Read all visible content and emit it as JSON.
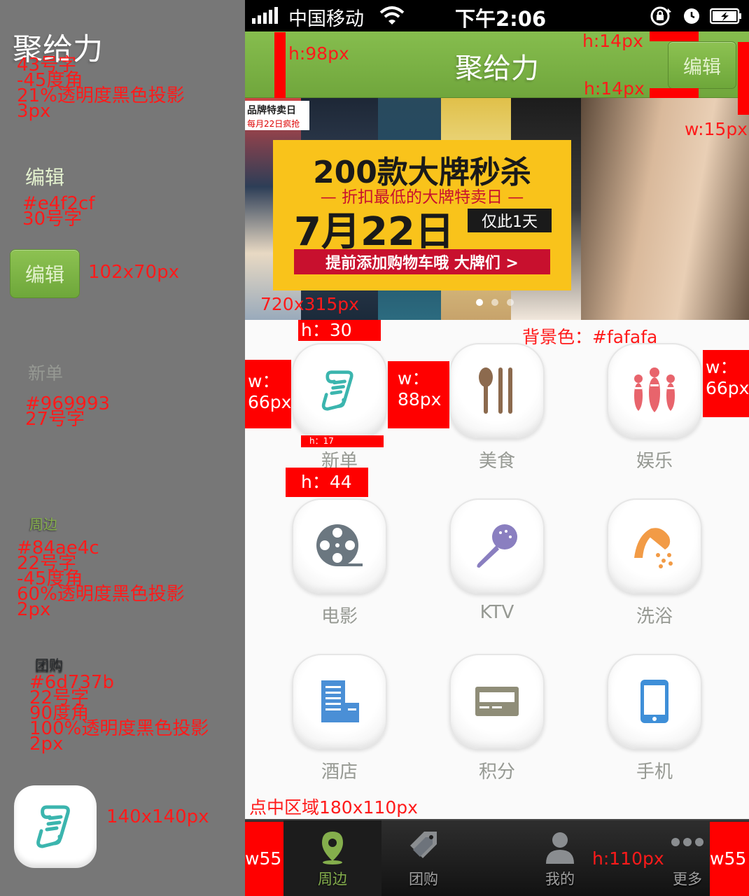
{
  "spec_panel": {
    "title_sample": "聚给力",
    "title_notes": "43号字\n-45度角\n21%透明度黑色投影\n3px",
    "edit_text_sample": "编辑",
    "edit_text_notes": "#e4f2cf\n30号字",
    "edit_button_sample": "编辑",
    "edit_button_size": "102x70px",
    "xindan_sample": "新单",
    "xindan_notes": "#969993\n27号字",
    "zhoubian_sample": "周边",
    "zhoubian_notes": "#84ae4c\n22号字\n-45度角\n60%透明度黑色投影\n2px",
    "tuangou_sample": "团购",
    "tuangou_notes": "#6d737b\n22号字\n90度角\n100%透明度黑色投影\n2px",
    "icon_size": "140x140px",
    "icon_sample": "new-order-scroll-icon"
  },
  "status_bar": {
    "carrier": "中国移动",
    "time": "下午2:06"
  },
  "nav": {
    "title": "聚给力",
    "edit_label": "编辑"
  },
  "banner": {
    "tag_line1": "品牌特卖日",
    "tag_line2": "每月22日疯抢",
    "headline": "200款大牌秒杀",
    "subline": "— 折扣最低的大牌特卖日 —",
    "date": "7月22日",
    "only_day": "仅此1天",
    "cta": "提前添加购物车哦  大牌们 >",
    "slide_count": 3,
    "active_slide": 1
  },
  "grid": {
    "items": [
      {
        "label": "新单",
        "icon": "new-order-scroll-icon"
      },
      {
        "label": "美食",
        "icon": "spoon-chopsticks-icon"
      },
      {
        "label": "娱乐",
        "icon": "bowling-pins-icon"
      },
      {
        "label": "电影",
        "icon": "film-reel-icon"
      },
      {
        "label": "KTV",
        "icon": "microphone-icon"
      },
      {
        "label": "洗浴",
        "icon": "shower-head-icon"
      },
      {
        "label": "酒店",
        "icon": "hotel-building-icon"
      },
      {
        "label": "积分",
        "icon": "points-card-icon"
      },
      {
        "label": "手机",
        "icon": "mobile-phone-icon"
      }
    ]
  },
  "tab_bar": {
    "tabs": [
      {
        "label": "周边",
        "icon": "location-pin-icon",
        "active": true
      },
      {
        "label": "团购",
        "icon": "tag-icon",
        "active": false
      },
      {
        "label": "我的",
        "icon": "user-icon",
        "active": false
      },
      {
        "label": "更多",
        "icon": "more-dots-icon",
        "active": false
      }
    ]
  },
  "annotations": {
    "nav_height": "h:98px",
    "top_pad": "h:14px",
    "bottom_pad": "h:14px",
    "right_margin": "w:15px",
    "banner_size": "720x315px",
    "icon_top_gap": "h：30",
    "bg_color": "背景色：#fafafa",
    "left_margin_w": "w：",
    "left_margin_v": "66px",
    "col_gap_w": "w：",
    "col_gap_v": "88px",
    "right_margin_w": "w：",
    "right_margin_v": "66px",
    "label_gap": "h：17",
    "row_gap": "h：44",
    "hit_area": "点中区域180x110px",
    "tab_left": "w55",
    "tab_height": "h:110px",
    "tab_right": "w55"
  },
  "colors": {
    "nav_green": "#7ab445",
    "edit_text": "#e4f2cf",
    "label_gray": "#969993",
    "tab_active": "#84ae4c",
    "tab_inactive": "#6d737b",
    "page_bg": "#fafafa",
    "annotation_red": "#ff0000"
  }
}
